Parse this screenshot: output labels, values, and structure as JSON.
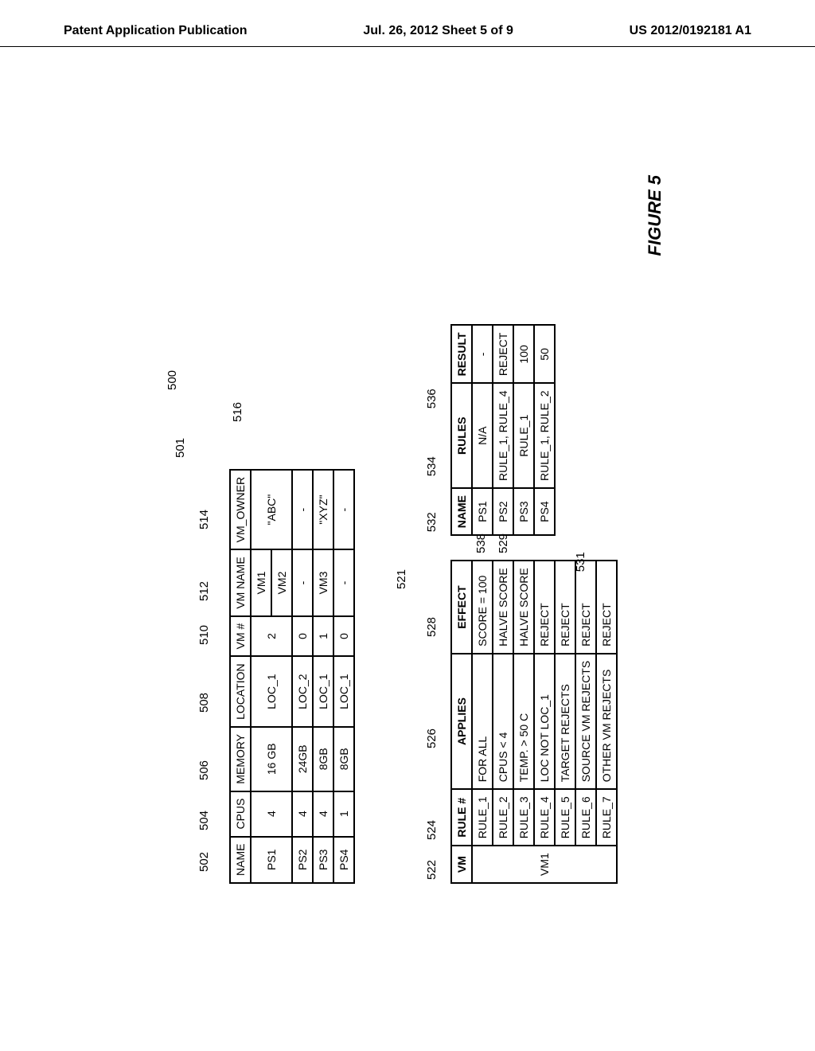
{
  "header": {
    "left": "Patent Application Publication",
    "center": "Jul. 26, 2012  Sheet 5 of 9",
    "right": "US 2012/0192181 A1"
  },
  "table501": {
    "headers": [
      "NAME",
      "CPUS",
      "MEMORY",
      "LOCATION",
      "VM #",
      "VM NAME",
      "VM_OWNER"
    ],
    "col_callouts": [
      "502",
      "504",
      "506",
      "508",
      "510",
      "512",
      "514"
    ],
    "ref_main": "501",
    "ref_group": "500",
    "ref_row": "516",
    "rows": [
      {
        "name": "PS1",
        "cpus": "4",
        "memory": "16 GB",
        "location": "LOC_1",
        "vmn": "2",
        "vmname": "VM1",
        "owner": "\"ABC\"",
        "rowspan_first": true
      },
      {
        "vmname": "VM2",
        "rowspan_second": true
      },
      {
        "name": "PS2",
        "cpus": "4",
        "memory": "24GB",
        "location": "LOC_2",
        "vmn": "0",
        "vmname": "-",
        "owner": "-"
      },
      {
        "name": "PS3",
        "cpus": "4",
        "memory": "8GB",
        "location": "LOC_1",
        "vmn": "1",
        "vmname": "VM3",
        "owner": "\"XYZ\""
      },
      {
        "name": "PS4",
        "cpus": "1",
        "memory": "8GB",
        "location": "LOC_1",
        "vmn": "0",
        "vmname": "-",
        "owner": "-"
      }
    ]
  },
  "table521": {
    "ref": "521",
    "headers": [
      "VM",
      "RULE #",
      "APPLIES",
      "EFFECT"
    ],
    "col_callouts": [
      "522",
      "524",
      "526",
      "528"
    ],
    "vm_label": "VM1",
    "row_ref_538": "538",
    "row_ref_529": "529",
    "rows": [
      [
        "RULE_1",
        "FOR ALL",
        "SCORE = 100"
      ],
      [
        "RULE_2",
        "CPUS < 4",
        "HALVE SCORE"
      ],
      [
        "RULE_3",
        "TEMP. > 50 C",
        "HALVE SCORE"
      ],
      [
        "RULE_4",
        "LOC NOT LOC_1",
        "REJECT"
      ],
      [
        "RULE_5",
        "TARGET REJECTS",
        "REJECT"
      ],
      [
        "RULE_6",
        "SOURCE VM REJECTS",
        "REJECT"
      ],
      [
        "RULE_7",
        "OTHER VM REJECTS",
        "REJECT"
      ]
    ]
  },
  "table531": {
    "ref": "531",
    "headers": [
      "NAME",
      "RULES",
      "RESULT"
    ],
    "col_callouts": [
      "532",
      "534",
      "536"
    ],
    "rows": [
      [
        "PS1",
        "N/A",
        "-"
      ],
      [
        "PS2",
        "RULE_1, RULE_4",
        "REJECT"
      ],
      [
        "PS3",
        "RULE_1",
        "100"
      ],
      [
        "PS4",
        "RULE_1, RULE_2",
        "50"
      ]
    ]
  },
  "figure_label": "FIGURE 5"
}
